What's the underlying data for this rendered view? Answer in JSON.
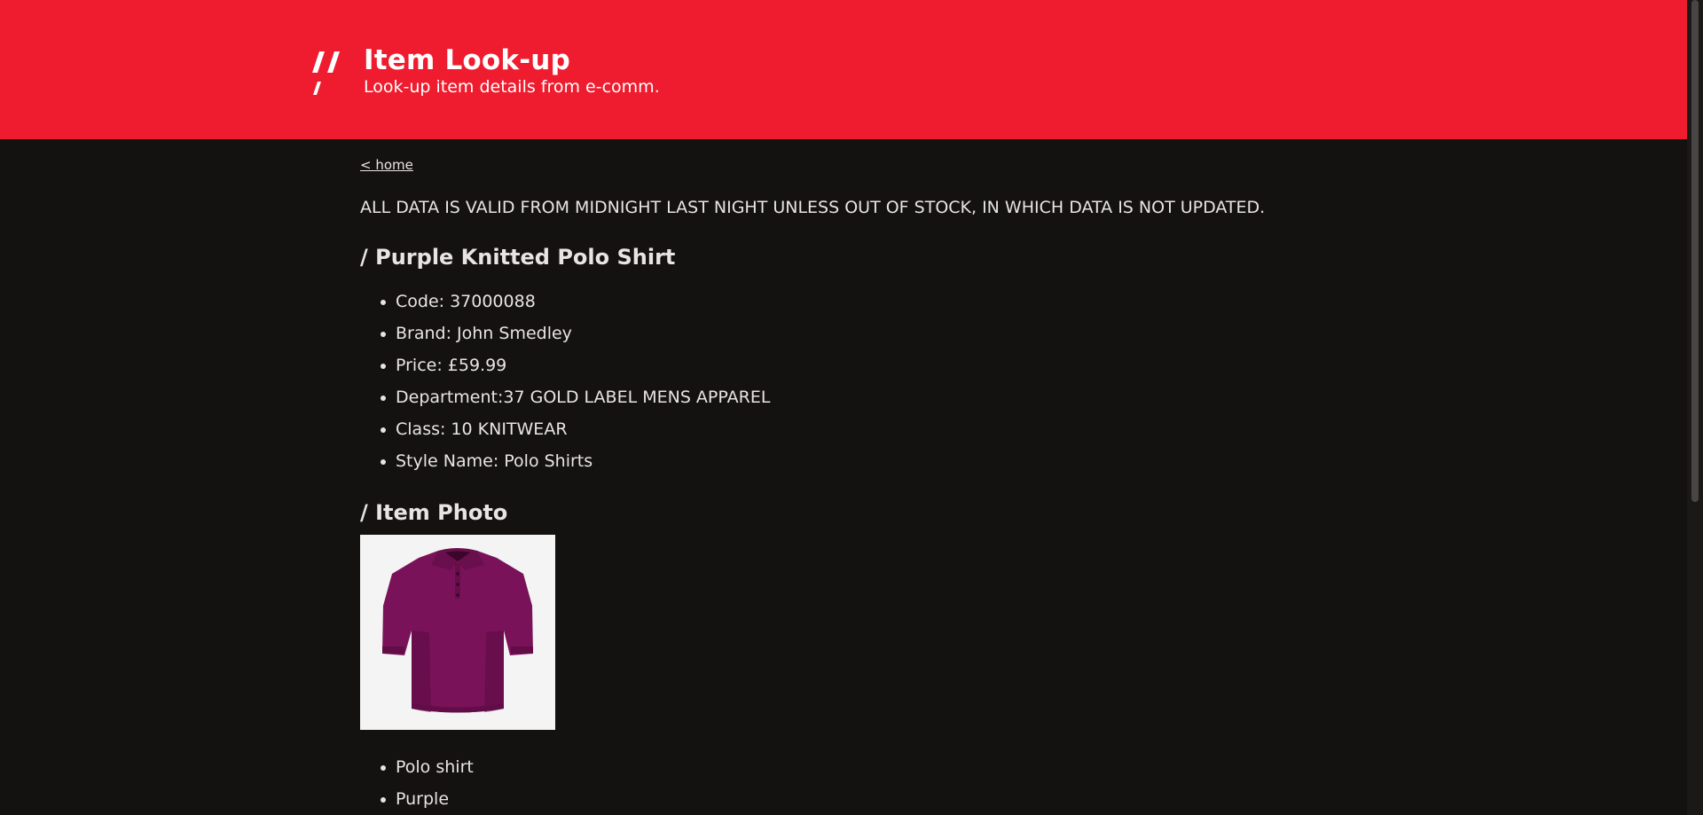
{
  "header": {
    "title": "Item Look-up",
    "subtitle": "Look-up item details from e-comm.",
    "brand_color": "#ee1c2e"
  },
  "nav": {
    "home_link": "< home"
  },
  "notice": "ALL DATA IS VALID FROM MIDNIGHT LAST NIGHT UNLESS OUT OF STOCK, IN WHICH DATA IS NOT UPDATED.",
  "product": {
    "heading": "/ Purple Knitted Polo Shirt",
    "details": [
      "Code: 37000088",
      "Brand: John Smedley",
      "Price: £59.99",
      "Department:37 GOLD LABEL MENS APPAREL",
      "Class: 10 KNITWEAR",
      "Style Name: Polo Shirts"
    ]
  },
  "photo_section": {
    "heading": "/ Item Photo",
    "image_icon": "polo-shirt-photo",
    "shirt_color": "#7a1259",
    "tags": [
      "Polo shirt",
      "Purple"
    ]
  }
}
